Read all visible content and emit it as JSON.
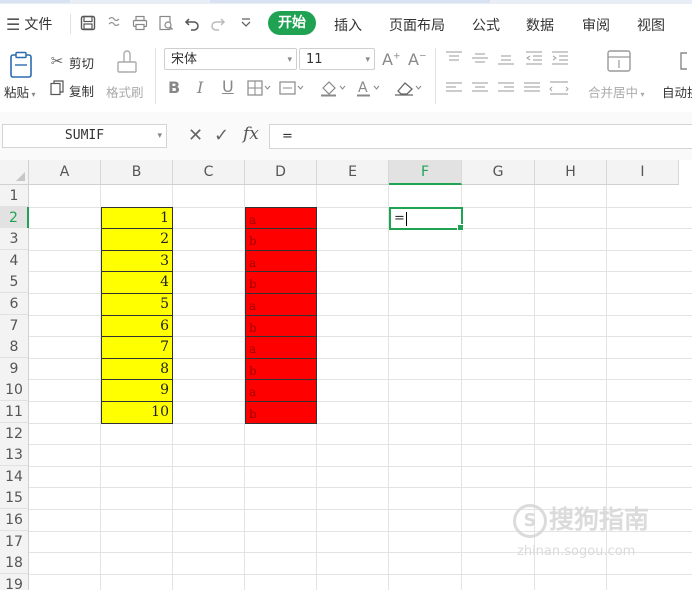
{
  "ribbon_tabs": {
    "file": "文件",
    "items": [
      "开始",
      "插入",
      "页面布局",
      "公式",
      "数据",
      "审阅",
      "视图"
    ],
    "active": "开始"
  },
  "clipboard": {
    "paste": "粘贴",
    "cut": "剪切",
    "copy": "复制",
    "format_painter": "格式刷"
  },
  "font": {
    "name": "宋体",
    "size": "11"
  },
  "alignment": {
    "merge_center": "合并居中",
    "wrap_text": "自动换"
  },
  "formula_bar": {
    "name_box": "SUMIF",
    "formula": "="
  },
  "sheet": {
    "columns": [
      "A",
      "B",
      "C",
      "D",
      "E",
      "F",
      "G",
      "H",
      "I"
    ],
    "selected_column": "F",
    "rows": [
      "1",
      "2",
      "3",
      "4",
      "5",
      "6",
      "7",
      "8",
      "9",
      "10",
      "11",
      "12",
      "13",
      "14",
      "15",
      "16",
      "17",
      "18",
      "19"
    ],
    "selected_row": "2",
    "column_b_values": [
      "1",
      "2",
      "3",
      "4",
      "5",
      "6",
      "7",
      "8",
      "9",
      "10"
    ],
    "column_d_values": [
      "a",
      "b",
      "a",
      "b",
      "a",
      "b",
      "a",
      "b",
      "a",
      "b"
    ],
    "active_cell_value": "=",
    "fill_b": "#ffff00",
    "fill_d": "#ff0000"
  },
  "accent_color": "#1fa353",
  "watermark": {
    "logo": "S",
    "text": "搜狗指南",
    "url": "zhinan.sogou.com"
  }
}
